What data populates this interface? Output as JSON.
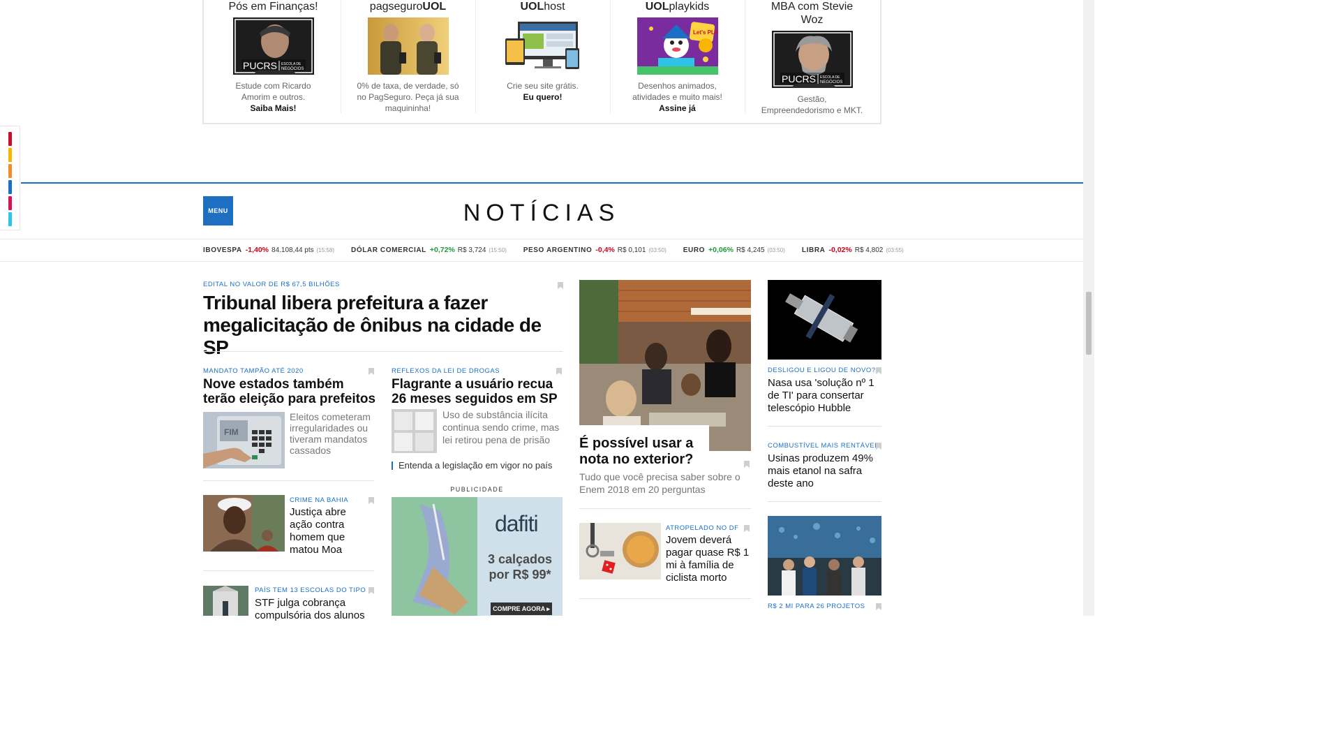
{
  "promos": [
    {
      "title": "Pós em Finanças!",
      "img_alt": "PUCRS Escola de Negócios",
      "text": "Estude com Ricardo Amorim e outros.",
      "cta": "Saiba Mais!"
    },
    {
      "title_a": "pagseguro",
      "title_b": "UOL",
      "img_alt": "Maquininha",
      "text": "0% de taxa, de verdade, só no PagSeguro. Peça já sua maquininha!",
      "cta": ""
    },
    {
      "title_a": "UOL",
      "title_b": "host",
      "img_alt": "Devices",
      "text": "Crie seu site grátis.",
      "cta": "Eu quero!"
    },
    {
      "title_a": "UOL",
      "title_b": "playkids",
      "img_alt": "Let's Play",
      "text": "Desenhos animados, atividades e muito mais!",
      "cta": "Assine já"
    },
    {
      "title": "MBA com Stevie Woz",
      "img_alt": "PUCRS Escola de Negócios",
      "text": "Gestão, Empreendedorismo e MKT.",
      "cta": ""
    }
  ],
  "promo_logo": {
    "word": "PUCRS",
    "sub1": "ESCOLA DE",
    "sub2": "NEGÓCIOS"
  },
  "playkids_badge": "Let's PLAY",
  "side_colors": [
    "#c8102e",
    "#f7b500",
    "#f28c28",
    "#1a6fc7",
    "#d4145a",
    "#2ec4e8"
  ],
  "header": {
    "menu_label": "MENU",
    "site_title": "NOTÍCIAS"
  },
  "ticker": [
    {
      "name": "IBOVESPA",
      "pct": "-1,40%",
      "dir": "down",
      "value": "84.108,44 pts",
      "time": "(15:58)"
    },
    {
      "name": "DÓLAR COMERCIAL",
      "pct": "+0,72%",
      "dir": "up",
      "value": "R$ 3,724",
      "time": "(15:50)"
    },
    {
      "name": "PESO ARGENTINO",
      "pct": "-0,4%",
      "dir": "down",
      "value": "R$ 0,101",
      "time": "(03:50)"
    },
    {
      "name": "EURO",
      "pct": "+0,06%",
      "dir": "up",
      "value": "R$ 4,245",
      "time": "(03:50)"
    },
    {
      "name": "LIBRA",
      "pct": "-0,02%",
      "dir": "down",
      "value": "R$ 4,802",
      "time": "(03:55)"
    }
  ],
  "main_story": {
    "kicker": "EDITAL NO VALOR DE R$ 67,5 BILHÕES",
    "headline": "Tribunal libera prefeitura a fazer megalicitação de ônibus na cidade de SP"
  },
  "story_a": {
    "kicker": "MANDATO TAMPÃO ATÉ 2020",
    "headline": "Nove estados também terão eleição para prefeitos",
    "summary": "Eleitos cometeram irregularidades ou tiveram mandatos cassados",
    "img_label": "FIM"
  },
  "story_b": {
    "kicker": "REFLEXOS DA LEI DE DROGAS",
    "headline": "Flagrante a usuário recua 26 meses seguidos em SP",
    "summary": "Uso de substância ilícita continua sendo crime, mas lei retirou pena de prisão",
    "related": "Entenda a legislação em vigor no país"
  },
  "story_c": {
    "kicker": "CRIME NA BAHIA",
    "headline": "Justiça abre ação contra homem que matou Moa"
  },
  "story_d": {
    "kicker": "PAÍS TEM 13 ESCOLAS DO TIPO",
    "headline": "STF julga cobrança compulsória dos alunos"
  },
  "ad": {
    "label": "PUBLICIDADE",
    "brand": "dafiti",
    "offer_line1": "3 calçados",
    "offer_line2": "por R$ 99*",
    "cta": "COMPRE AGORA ▸"
  },
  "feature": {
    "headline": "É possível usar a nota no exterior?",
    "summary": "Tudo que você precisa saber sobre o Enem 2018 em 20 perguntas"
  },
  "story_e": {
    "kicker": "ATROPELADO NO DF",
    "headline": "Jovem deverá pagar quase R$ 1 mi à família de ciclista morto"
  },
  "side_story_1": {
    "kicker": "DESLIGOU E LIGOU DE NOVO?",
    "headline": "Nasa usa 'solução nº 1 de TI' para consertar telescópio Hubble"
  },
  "side_story_2": {
    "kicker": "COMBUSTÍVEL MAIS RENTÁVEL",
    "headline": "Usinas produzem 49% mais etanol na safra deste ano"
  },
  "side_story_3": {
    "kicker": "R$ 2 MI PARA 26 PROJETOS",
    "headline": ""
  }
}
